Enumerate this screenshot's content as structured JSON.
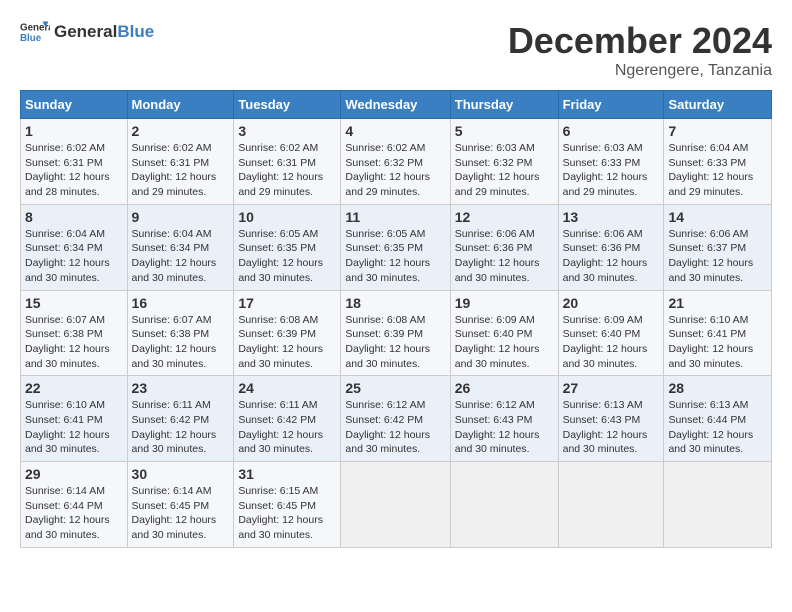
{
  "logo": {
    "general": "General",
    "blue": "Blue"
  },
  "title": {
    "month_year": "December 2024",
    "location": "Ngerengere, Tanzania"
  },
  "calendar": {
    "headers": [
      "Sunday",
      "Monday",
      "Tuesday",
      "Wednesday",
      "Thursday",
      "Friday",
      "Saturday"
    ],
    "weeks": [
      [
        {
          "day": "1",
          "sunrise": "6:02 AM",
          "sunset": "6:31 PM",
          "daylight": "12 hours and 28 minutes."
        },
        {
          "day": "2",
          "sunrise": "6:02 AM",
          "sunset": "6:31 PM",
          "daylight": "12 hours and 29 minutes."
        },
        {
          "day": "3",
          "sunrise": "6:02 AM",
          "sunset": "6:31 PM",
          "daylight": "12 hours and 29 minutes."
        },
        {
          "day": "4",
          "sunrise": "6:02 AM",
          "sunset": "6:32 PM",
          "daylight": "12 hours and 29 minutes."
        },
        {
          "day": "5",
          "sunrise": "6:03 AM",
          "sunset": "6:32 PM",
          "daylight": "12 hours and 29 minutes."
        },
        {
          "day": "6",
          "sunrise": "6:03 AM",
          "sunset": "6:33 PM",
          "daylight": "12 hours and 29 minutes."
        },
        {
          "day": "7",
          "sunrise": "6:04 AM",
          "sunset": "6:33 PM",
          "daylight": "12 hours and 29 minutes."
        }
      ],
      [
        {
          "day": "8",
          "sunrise": "6:04 AM",
          "sunset": "6:34 PM",
          "daylight": "12 hours and 30 minutes."
        },
        {
          "day": "9",
          "sunrise": "6:04 AM",
          "sunset": "6:34 PM",
          "daylight": "12 hours and 30 minutes."
        },
        {
          "day": "10",
          "sunrise": "6:05 AM",
          "sunset": "6:35 PM",
          "daylight": "12 hours and 30 minutes."
        },
        {
          "day": "11",
          "sunrise": "6:05 AM",
          "sunset": "6:35 PM",
          "daylight": "12 hours and 30 minutes."
        },
        {
          "day": "12",
          "sunrise": "6:06 AM",
          "sunset": "6:36 PM",
          "daylight": "12 hours and 30 minutes."
        },
        {
          "day": "13",
          "sunrise": "6:06 AM",
          "sunset": "6:36 PM",
          "daylight": "12 hours and 30 minutes."
        },
        {
          "day": "14",
          "sunrise": "6:06 AM",
          "sunset": "6:37 PM",
          "daylight": "12 hours and 30 minutes."
        }
      ],
      [
        {
          "day": "15",
          "sunrise": "6:07 AM",
          "sunset": "6:38 PM",
          "daylight": "12 hours and 30 minutes."
        },
        {
          "day": "16",
          "sunrise": "6:07 AM",
          "sunset": "6:38 PM",
          "daylight": "12 hours and 30 minutes."
        },
        {
          "day": "17",
          "sunrise": "6:08 AM",
          "sunset": "6:39 PM",
          "daylight": "12 hours and 30 minutes."
        },
        {
          "day": "18",
          "sunrise": "6:08 AM",
          "sunset": "6:39 PM",
          "daylight": "12 hours and 30 minutes."
        },
        {
          "day": "19",
          "sunrise": "6:09 AM",
          "sunset": "6:40 PM",
          "daylight": "12 hours and 30 minutes."
        },
        {
          "day": "20",
          "sunrise": "6:09 AM",
          "sunset": "6:40 PM",
          "daylight": "12 hours and 30 minutes."
        },
        {
          "day": "21",
          "sunrise": "6:10 AM",
          "sunset": "6:41 PM",
          "daylight": "12 hours and 30 minutes."
        }
      ],
      [
        {
          "day": "22",
          "sunrise": "6:10 AM",
          "sunset": "6:41 PM",
          "daylight": "12 hours and 30 minutes."
        },
        {
          "day": "23",
          "sunrise": "6:11 AM",
          "sunset": "6:42 PM",
          "daylight": "12 hours and 30 minutes."
        },
        {
          "day": "24",
          "sunrise": "6:11 AM",
          "sunset": "6:42 PM",
          "daylight": "12 hours and 30 minutes."
        },
        {
          "day": "25",
          "sunrise": "6:12 AM",
          "sunset": "6:42 PM",
          "daylight": "12 hours and 30 minutes."
        },
        {
          "day": "26",
          "sunrise": "6:12 AM",
          "sunset": "6:43 PM",
          "daylight": "12 hours and 30 minutes."
        },
        {
          "day": "27",
          "sunrise": "6:13 AM",
          "sunset": "6:43 PM",
          "daylight": "12 hours and 30 minutes."
        },
        {
          "day": "28",
          "sunrise": "6:13 AM",
          "sunset": "6:44 PM",
          "daylight": "12 hours and 30 minutes."
        }
      ],
      [
        {
          "day": "29",
          "sunrise": "6:14 AM",
          "sunset": "6:44 PM",
          "daylight": "12 hours and 30 minutes."
        },
        {
          "day": "30",
          "sunrise": "6:14 AM",
          "sunset": "6:45 PM",
          "daylight": "12 hours and 30 minutes."
        },
        {
          "day": "31",
          "sunrise": "6:15 AM",
          "sunset": "6:45 PM",
          "daylight": "12 hours and 30 minutes."
        },
        null,
        null,
        null,
        null
      ]
    ]
  }
}
